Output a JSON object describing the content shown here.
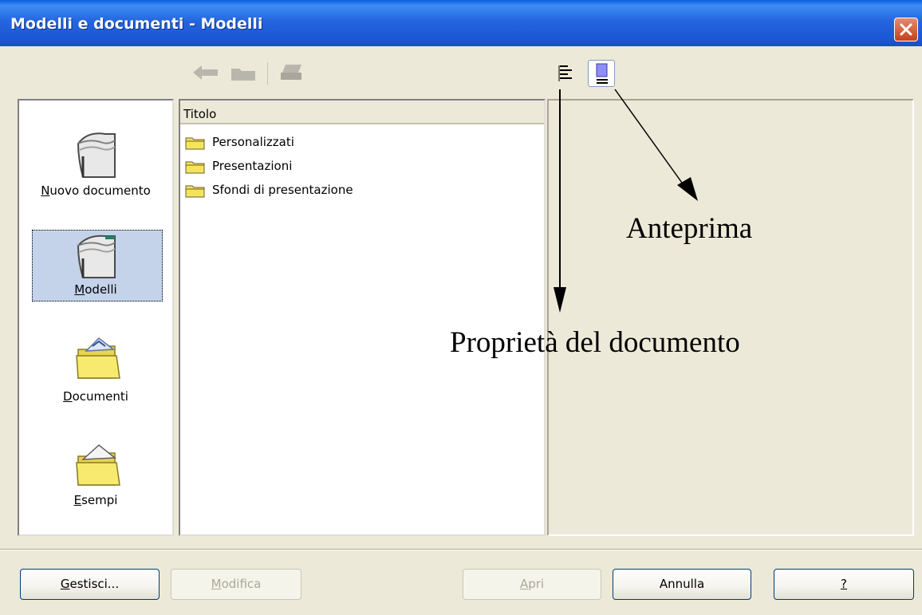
{
  "window": {
    "title": "Modelli e documenti - Modelli"
  },
  "toolbar": {
    "back_icon": "arrow-left-icon",
    "up_icon": "folder-up-icon",
    "print_icon": "print-icon",
    "properties_icon": "document-properties-icon",
    "preview_icon": "preview-icon"
  },
  "categories": [
    {
      "label": "Nuovo documento",
      "accesskey": "N",
      "rest": "uovo documento",
      "icon": "new-document-icon",
      "selected": false
    },
    {
      "label": "Modelli",
      "accesskey": "M",
      "rest": "odelli",
      "icon": "templates-icon",
      "selected": true
    },
    {
      "label": "Documenti",
      "accesskey": "D",
      "rest": "ocumenti",
      "icon": "documents-folder-icon",
      "selected": false
    },
    {
      "label": "Esempi",
      "accesskey": "E",
      "rest": "sempi",
      "icon": "samples-folder-icon",
      "selected": false
    }
  ],
  "list": {
    "header": "Titolo",
    "items": [
      {
        "name": "Personalizzati",
        "icon": "folder-icon"
      },
      {
        "name": "Presentazioni",
        "icon": "folder-icon"
      },
      {
        "name": "Sfondi di presentazione",
        "icon": "folder-icon"
      }
    ]
  },
  "annotations": {
    "preview": "Anteprima",
    "properties": "Proprietà del documento"
  },
  "buttons": {
    "manage": {
      "accesskey": "G",
      "rest": "estisci...",
      "enabled": true
    },
    "edit": {
      "accesskey": "M",
      "rest": "odifica",
      "enabled": false
    },
    "open": {
      "accesskey": "A",
      "rest": "pri",
      "enabled": false
    },
    "cancel": {
      "label": "Annulla",
      "enabled": true
    },
    "help": {
      "label": "?",
      "enabled": true
    }
  },
  "colors": {
    "titlebar": "#2466df",
    "selection": "#c4d2ea",
    "dialog_bg": "#ece9d8",
    "folder_yellow": "#f5e35d"
  }
}
